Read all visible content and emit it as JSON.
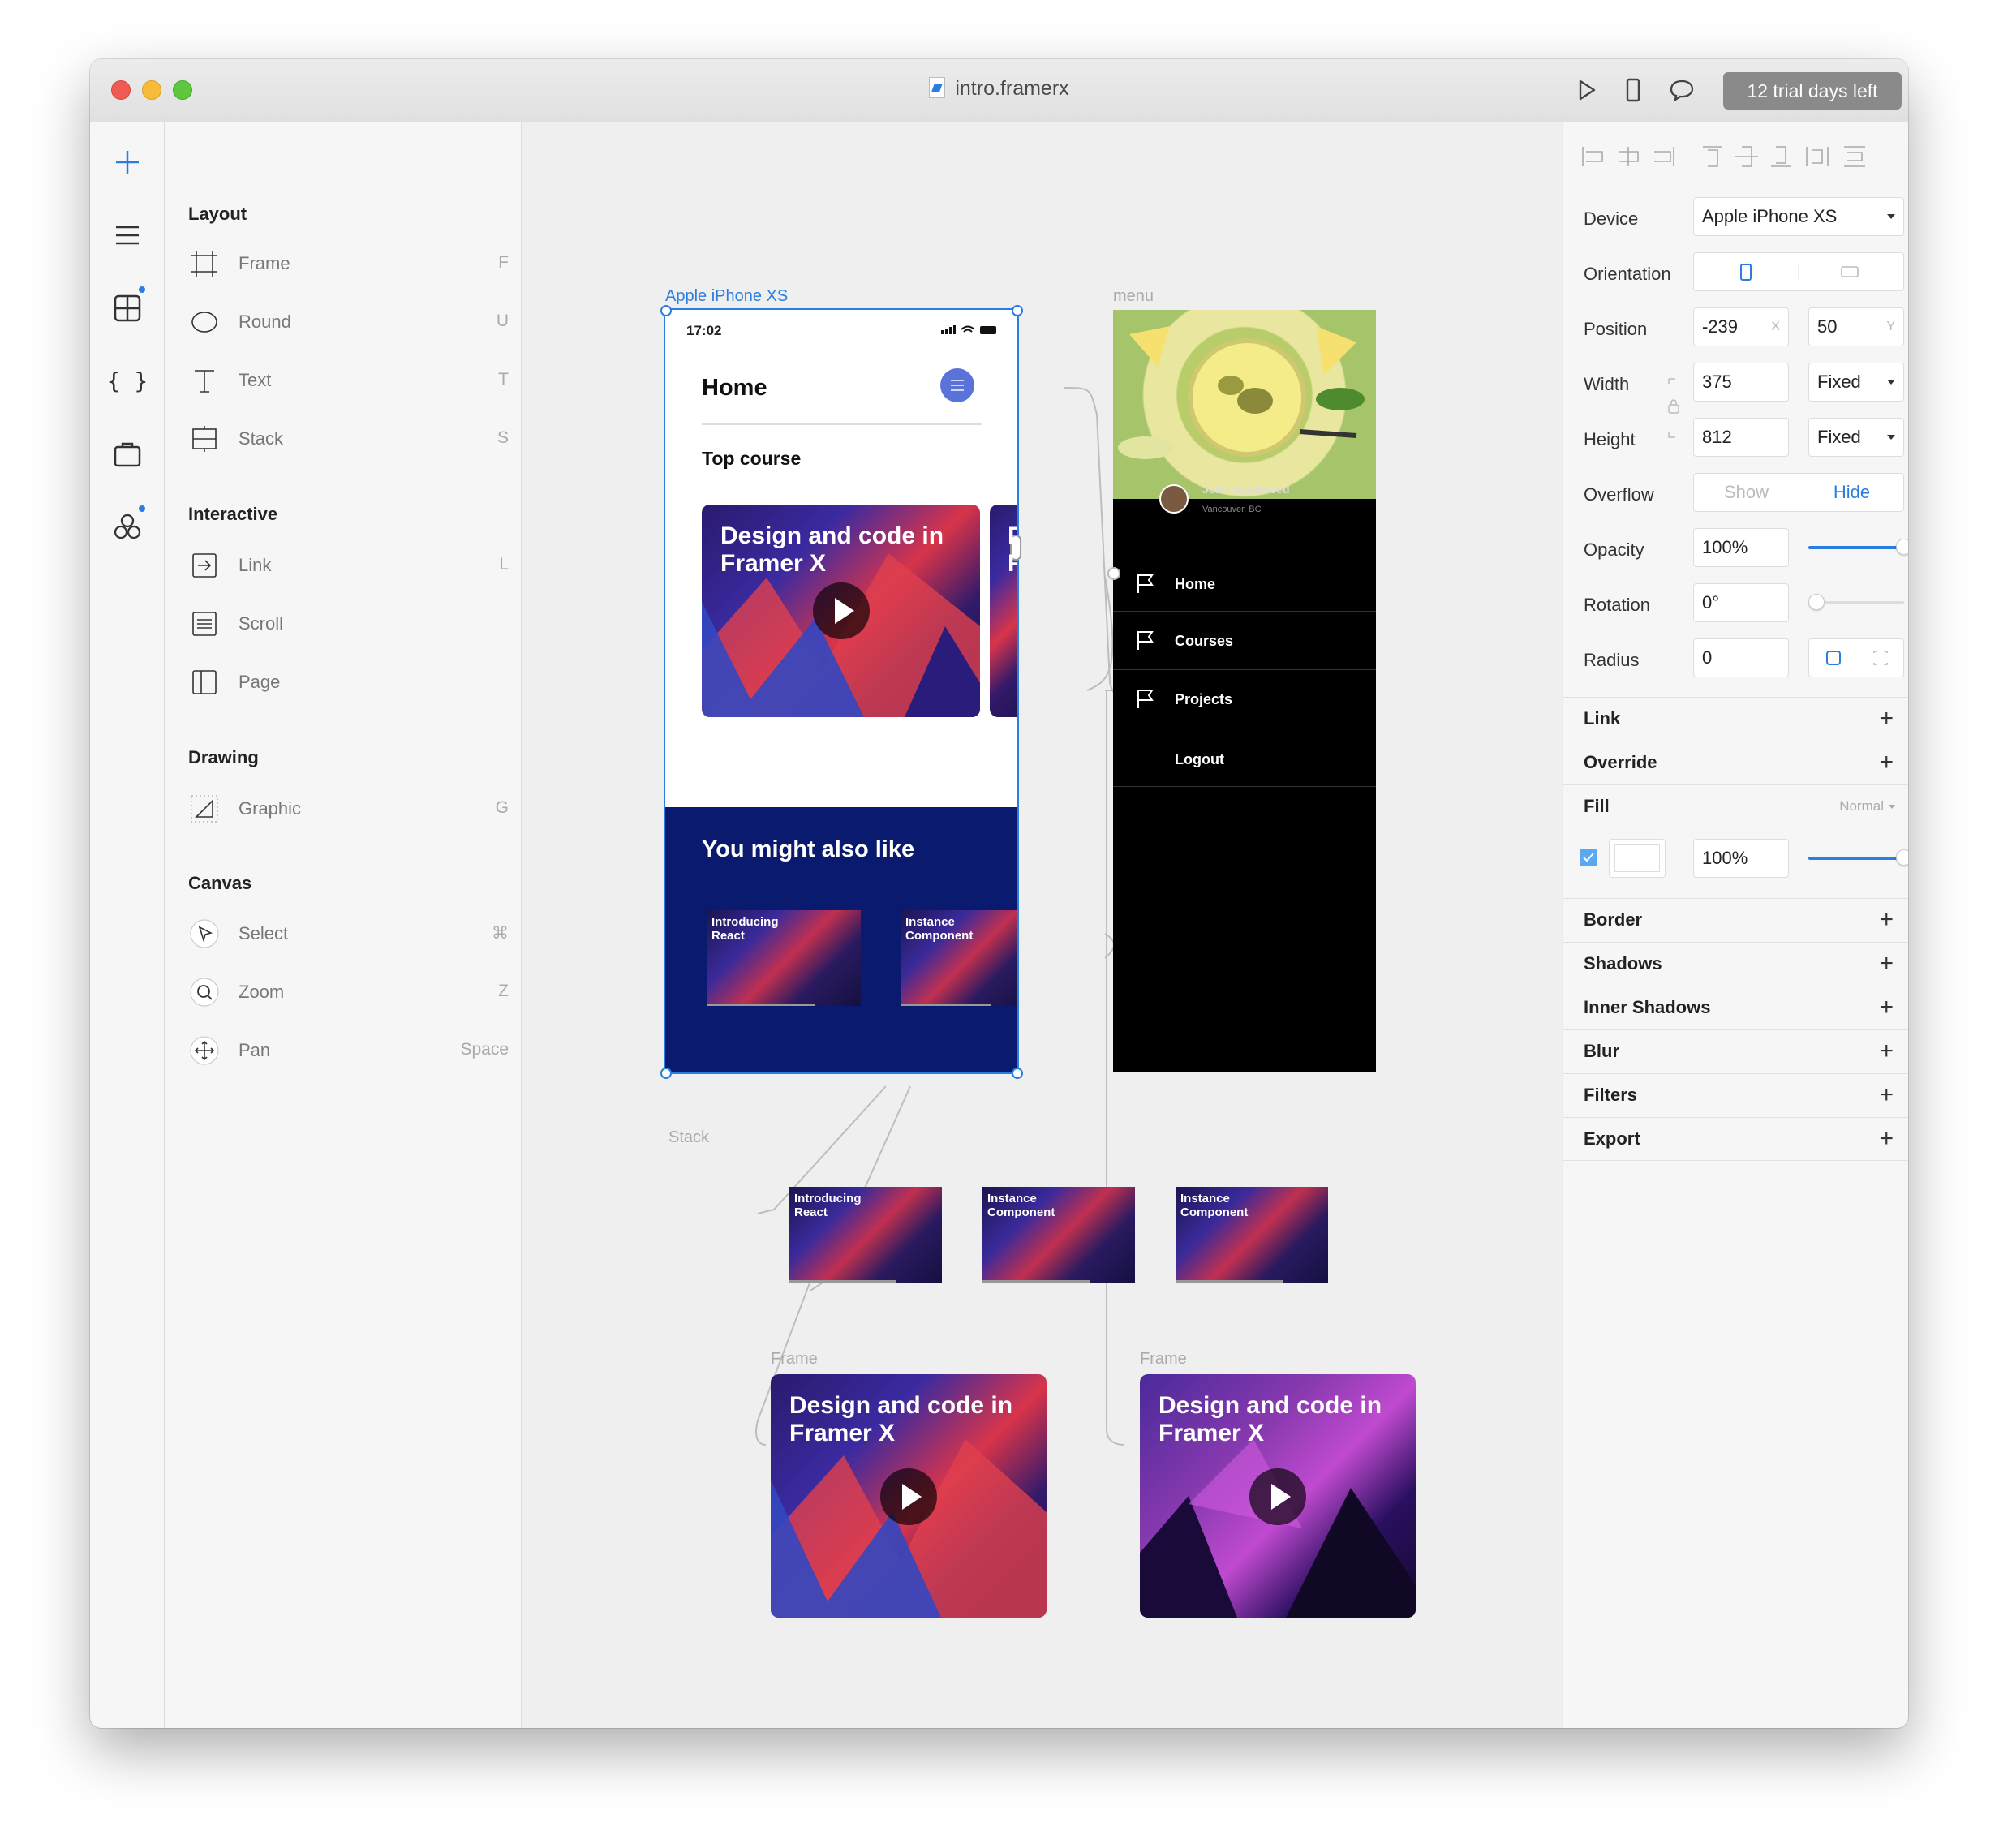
{
  "window": {
    "title": "intro.framerx",
    "trial": "12 trial days left"
  },
  "left_panel": {
    "sections": {
      "layout": "Layout",
      "interactive": "Interactive",
      "drawing": "Drawing",
      "canvas": "Canvas"
    },
    "tools": {
      "frame": {
        "label": "Frame",
        "key": "F"
      },
      "round": {
        "label": "Round",
        "key": "U"
      },
      "text": {
        "label": "Text",
        "key": "T"
      },
      "stack": {
        "label": "Stack",
        "key": "S"
      },
      "link": {
        "label": "Link",
        "key": "L"
      },
      "scroll": {
        "label": "Scroll",
        "key": ""
      },
      "page": {
        "label": "Page",
        "key": ""
      },
      "graphic": {
        "label": "Graphic",
        "key": "G"
      },
      "select": {
        "label": "Select",
        "key": "⌘"
      },
      "zoom": {
        "label": "Zoom",
        "key": "Z"
      },
      "pan": {
        "label": "Pan",
        "key": "Space"
      }
    }
  },
  "canvas": {
    "iphone": {
      "label": "Apple iPhone XS",
      "time": "17:02",
      "home": "Home",
      "top_course": "Top course",
      "card_title": "Design and code in Framer X",
      "peek_title": "D F",
      "also_like": "You might also like",
      "thumb1": "Introducing React",
      "thumb2": "Instance Component"
    },
    "menu": {
      "label": "menu",
      "user_name": "John Appleseed",
      "user_location": "Vancouver, BC",
      "items": [
        "Home",
        "Courses",
        "Projects",
        "Logout"
      ]
    },
    "stack": {
      "label": "Stack",
      "thumbs": [
        "Introducing React",
        "Instance Component",
        "Instance Component"
      ]
    },
    "frame1": {
      "label": "Frame",
      "title": "Design and code in Framer X"
    },
    "frame2": {
      "label": "Frame",
      "title": "Design and code in Framer X"
    }
  },
  "inspector": {
    "device": {
      "label": "Device",
      "value": "Apple iPhone XS"
    },
    "orientation": {
      "label": "Orientation"
    },
    "position": {
      "label": "Position",
      "x": "-239",
      "x_suffix": "X",
      "y": "50",
      "y_suffix": "Y"
    },
    "width": {
      "label": "Width",
      "value": "375",
      "mode": "Fixed"
    },
    "height": {
      "label": "Height",
      "value": "812",
      "mode": "Fixed"
    },
    "overflow": {
      "label": "Overflow",
      "show": "Show",
      "hide": "Hide"
    },
    "opacity": {
      "label": "Opacity",
      "value": "100%",
      "level": 1.0
    },
    "rotation": {
      "label": "Rotation",
      "value": "0°"
    },
    "radius": {
      "label": "Radius",
      "value": "0"
    },
    "fill": {
      "label": "Fill",
      "mode": "Normal",
      "opacity": "100%",
      "color": "#FFFFFF"
    },
    "sections": [
      "Link",
      "Override",
      "Border",
      "Shadows",
      "Inner Shadows",
      "Blur",
      "Filters",
      "Export"
    ]
  },
  "colors": {
    "accent": "#2A7DE1",
    "navy": "#0A1A6E",
    "menu_bg": "#000000"
  }
}
